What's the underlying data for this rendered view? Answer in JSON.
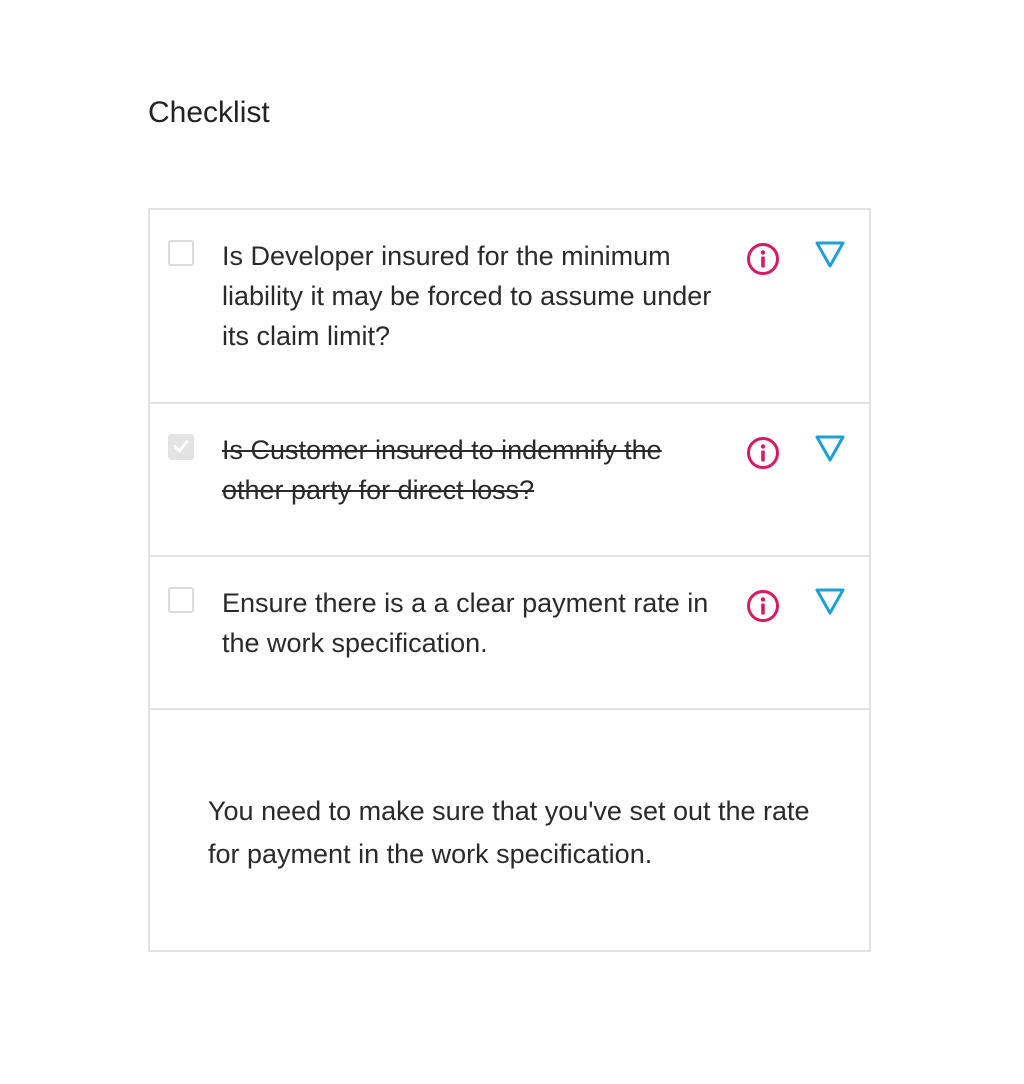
{
  "page": {
    "title": "Checklist"
  },
  "checklist": {
    "items": [
      {
        "text": "Is Developer insured for the minimum liability it may be forced to assume under its claim limit?",
        "checked": false,
        "info_icon": "info-circle-icon",
        "expand_icon": "triangle-down-icon"
      },
      {
        "text": "Is Customer insured to indemnify the other party for direct loss?",
        "checked": true,
        "info_icon": "info-circle-icon",
        "expand_icon": "triangle-down-icon"
      },
      {
        "text": "Ensure there is a a clear payment rate in the work specification.",
        "checked": false,
        "info_icon": "info-circle-icon",
        "expand_icon": "triangle-down-icon"
      }
    ],
    "detail": {
      "text": "You need to make sure that you've set out the rate for payment in the work specification."
    }
  },
  "colors": {
    "info": "#d81b60",
    "expand": "#1e9fd6",
    "border": "#e2e2e2",
    "checked_box": "#e3e3e3",
    "text": "#2a2a2a"
  }
}
